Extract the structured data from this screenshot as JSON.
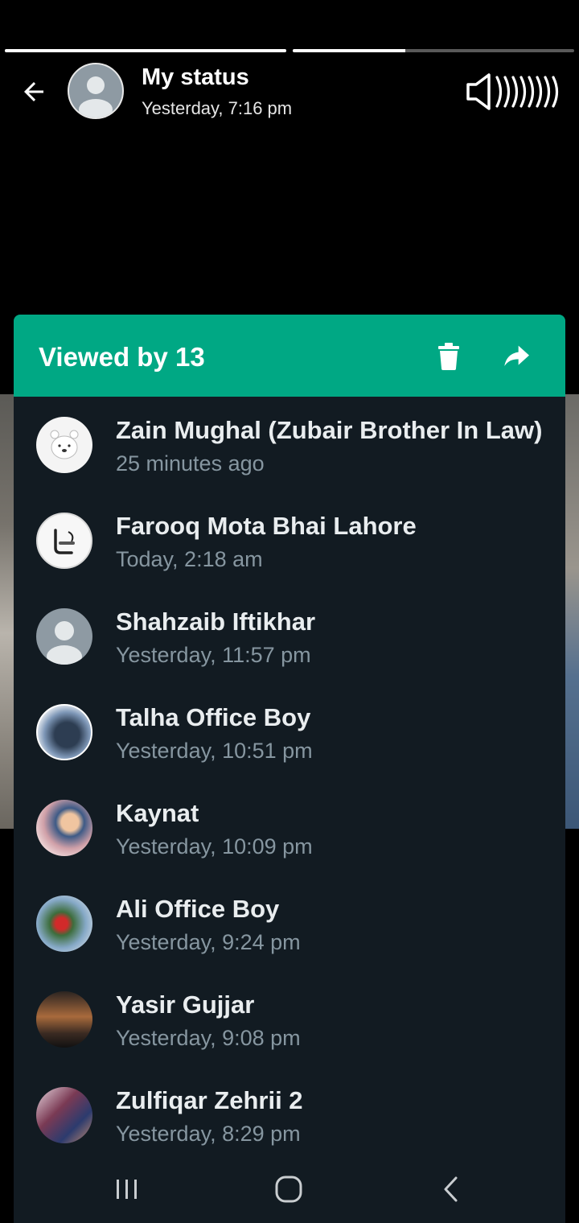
{
  "status": {
    "title": "My status",
    "timestamp": "Yesterday, 7:16 pm",
    "progress": [
      1.0,
      0.4
    ]
  },
  "icons": {
    "back": "arrow-left-icon",
    "volume": "speaker-icon",
    "delete": "trash-icon",
    "forward": "share-forward-icon"
  },
  "sheet": {
    "title": "Viewed by 13",
    "accent_color": "#00a884",
    "background_color": "#121b22"
  },
  "viewers": [
    {
      "name": "Zain Mughal (Zubair Brother In Law)",
      "time": "25 minutes ago"
    },
    {
      "name": "Farooq Mota Bhai Lahore",
      "time": "Today, 2:18 am"
    },
    {
      "name": "Shahzaib Iftikhar",
      "time": "Yesterday, 11:57 pm"
    },
    {
      "name": "Talha Office Boy",
      "time": "Yesterday, 10:51 pm"
    },
    {
      "name": "Kaynat",
      "time": "Yesterday, 10:09 pm"
    },
    {
      "name": "Ali Office Boy",
      "time": "Yesterday, 9:24 pm"
    },
    {
      "name": "Yasir Gujjar",
      "time": "Yesterday, 9:08 pm"
    },
    {
      "name": "Zulfiqar Zehrii 2",
      "time": "Yesterday, 8:29 pm"
    }
  ],
  "navbar": {
    "recents": "recents-icon",
    "home": "home-icon",
    "back": "nav-back-icon"
  }
}
